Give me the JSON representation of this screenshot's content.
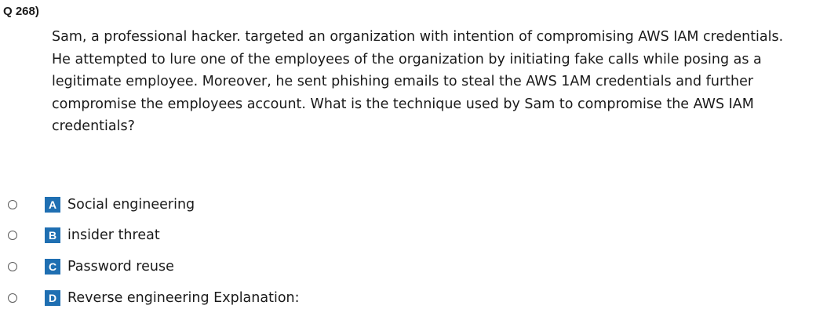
{
  "question": {
    "number": "Q 268)",
    "text": "Sam, a professional hacker. targeted an organization with intention of compromising AWS IAM credentials. He attempted to lure one of the employees of the organization by initiating fake calls while posing as a legitimate employee. Moreover, he sent phishing emails to steal the AWS 1AM credentials and further compromise the employees account. What is the technique used by Sam to compromise the AWS IAM credentials?"
  },
  "options": [
    {
      "letter": "A",
      "text": "Social engineering"
    },
    {
      "letter": "B",
      "text": "insider threat"
    },
    {
      "letter": "C",
      "text": "Password reuse"
    },
    {
      "letter": "D",
      "text": "Reverse engineering Explanation:"
    }
  ],
  "colors": {
    "badge": "#1f6fb2",
    "text": "#1a1a1a"
  }
}
